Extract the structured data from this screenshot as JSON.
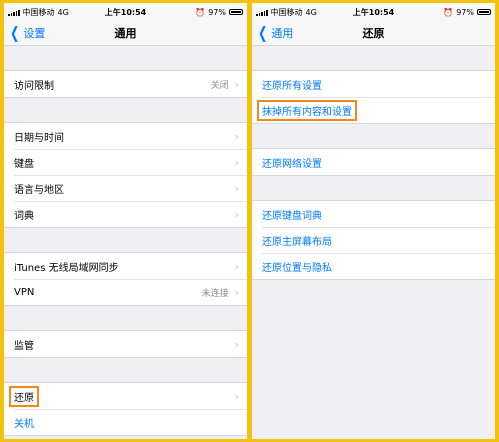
{
  "left": {
    "status": {
      "carrier": "中国移动",
      "network": "4G",
      "time": "上午10:54",
      "battery": "97%"
    },
    "nav": {
      "back_label": "设置",
      "title": "通用"
    },
    "groups": [
      [
        {
          "label": "访问限制",
          "value": "关闭"
        }
      ],
      [
        {
          "label": "日期与时间"
        },
        {
          "label": "键盘"
        },
        {
          "label": "语言与地区"
        },
        {
          "label": "词典"
        }
      ],
      [
        {
          "label": "iTunes 无线局域网同步"
        },
        {
          "label": "VPN",
          "value": "未连接"
        }
      ],
      [
        {
          "label": "监管"
        }
      ],
      [
        {
          "label": "还原"
        },
        {
          "label": "关机"
        }
      ]
    ]
  },
  "right": {
    "status": {
      "carrier": "中国移动",
      "network": "4G",
      "time": "上午10:54",
      "battery": "97%"
    },
    "nav": {
      "back_label": "通用",
      "title": "还原"
    },
    "groups": [
      [
        {
          "label": "还原所有设置"
        },
        {
          "label": "抹掉所有内容和设置"
        }
      ],
      [
        {
          "label": "还原网络设置"
        }
      ],
      [
        {
          "label": "还原键盘词典"
        },
        {
          "label": "还原主屏幕布局"
        },
        {
          "label": "还原位置与隐私"
        }
      ]
    ]
  },
  "colors": {
    "accent": "#007aff",
    "highlight": "#f08a1c",
    "frame": "#f2c20d"
  }
}
